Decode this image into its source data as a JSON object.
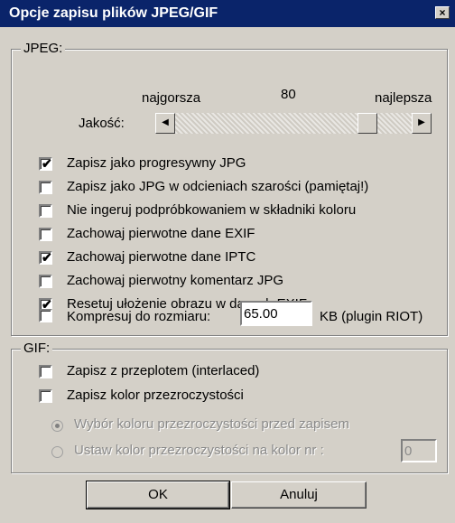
{
  "window": {
    "title": "Opcje zapisu plików JPEG/GIF",
    "close_glyph": "×"
  },
  "jpeg": {
    "group_label": "JPEG:",
    "quality": {
      "label": "Jakość:",
      "min_label": "najgorsza",
      "max_label": "najlepsza",
      "value": "80"
    },
    "options": [
      {
        "label": "Zapisz jako progresywny JPG",
        "checked": true
      },
      {
        "label": "Zapisz jako JPG w odcieniach szarości  (pamiętaj!)",
        "checked": false
      },
      {
        "label": "Nie ingeruj podpróbkowaniem w składniki koloru",
        "checked": false
      },
      {
        "label": "Zachowaj pierwotne dane EXIF",
        "checked": false
      },
      {
        "label": "Zachowaj pierwotne dane IPTC",
        "checked": true
      },
      {
        "label": "Zachowaj pierwotny komentarz JPG",
        "checked": false
      },
      {
        "label": "Resetuj ułożenie obrazu w danych EXIF",
        "checked": true
      }
    ],
    "compress": {
      "label": "Kompresuj do rozmiaru:",
      "value": "65.00",
      "suffix": "KB (plugin RIOT)",
      "checked": false
    }
  },
  "gif": {
    "group_label": "GIF:",
    "options": [
      {
        "label": "Zapisz z przeplotem (interlaced)",
        "checked": false
      },
      {
        "label": "Zapisz kolor przezroczystości",
        "checked": false
      }
    ],
    "radio1": {
      "label": "Wybór koloru przezroczystości przed zapisem",
      "selected": true
    },
    "radio2": {
      "label": "Ustaw kolor przezroczystości na kolor nr :",
      "selected": false,
      "value": "0"
    }
  },
  "buttons": {
    "ok": "OK",
    "cancel": "Anuluj"
  },
  "check_glyph": "✔"
}
